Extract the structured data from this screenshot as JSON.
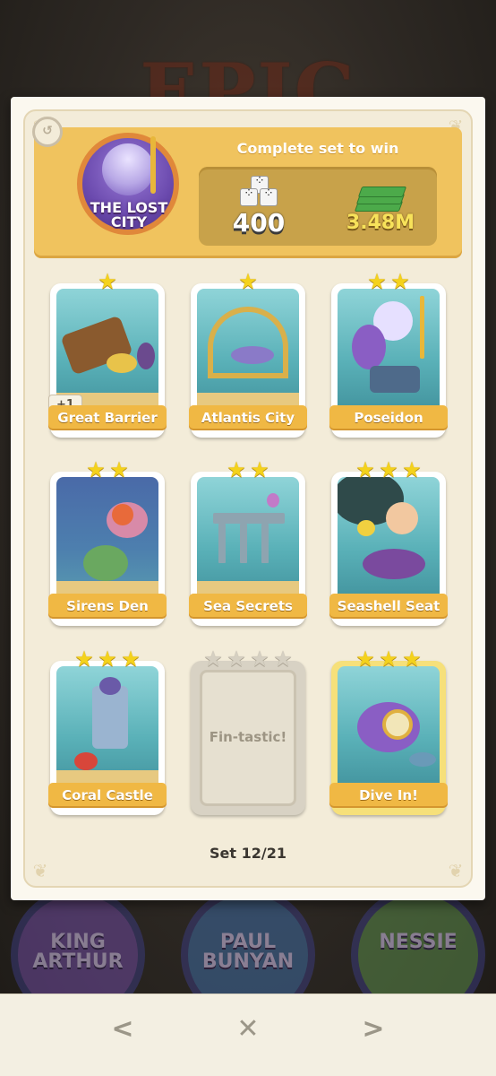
{
  "background": {
    "title": "EPIC",
    "albums": [
      "KING ARTHUR",
      "PAUL BUNYAN",
      "NESSIE"
    ]
  },
  "header": {
    "set_name": "THE LOST CITY",
    "reward_title": "Complete set to win",
    "dice_reward": "400",
    "cash_reward": "3.48M"
  },
  "cards": [
    {
      "name": "Great Barrier",
      "stars": 1,
      "extra": "+1",
      "collected": true
    },
    {
      "name": "Atlantis City",
      "stars": 1,
      "collected": true
    },
    {
      "name": "Poseidon",
      "stars": 2,
      "collected": true
    },
    {
      "name": "Sirens Den",
      "stars": 2,
      "collected": true
    },
    {
      "name": "Sea Secrets",
      "stars": 2,
      "collected": true
    },
    {
      "name": "Seashell Seat",
      "stars": 3,
      "collected": true
    },
    {
      "name": "Coral Castle",
      "stars": 3,
      "collected": true
    },
    {
      "name": "Fin-tastic!",
      "stars": 4,
      "collected": false
    },
    {
      "name": "Dive In!",
      "stars": 3,
      "collected": true
    }
  ],
  "progress": "Set 12/21",
  "nav": {
    "prev": "<",
    "close": "✕",
    "next": ">"
  },
  "colors": {
    "accent": "#f0c35e",
    "label": "#f0b844",
    "star": "#f4d21c"
  }
}
